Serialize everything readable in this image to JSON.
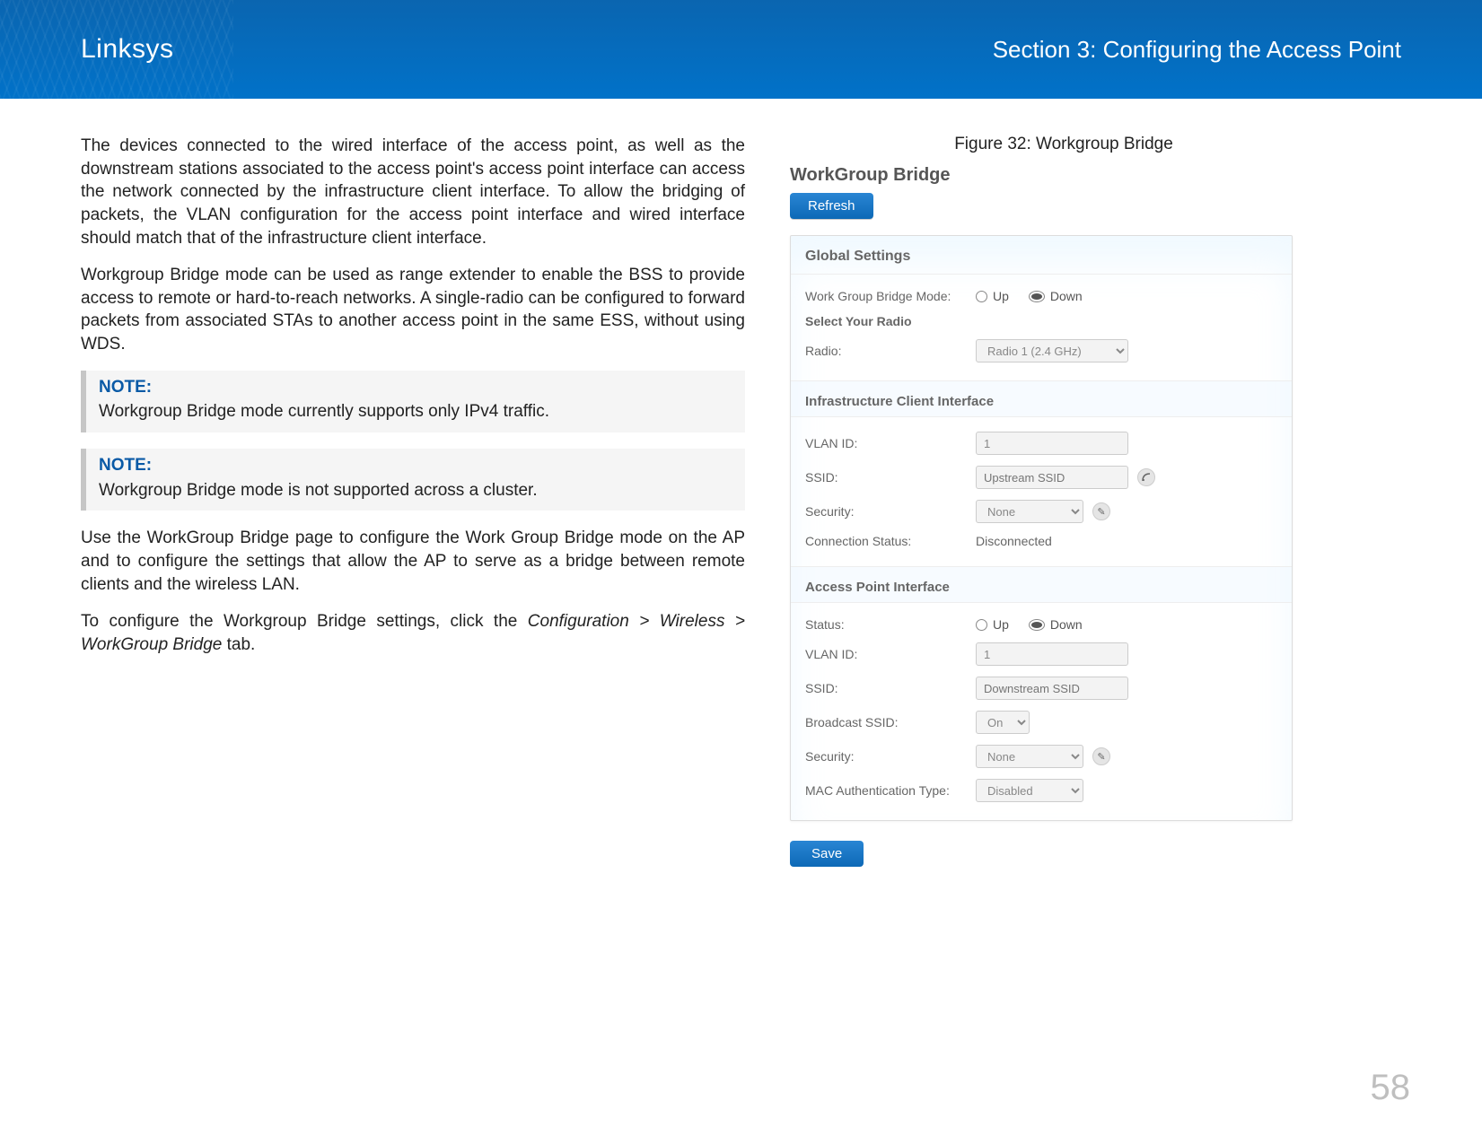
{
  "header": {
    "brand": "Linksys",
    "section": "Section 3:  Configuring the Access Point"
  },
  "left": {
    "p1": "The devices connected to the wired interface of the access point, as well as the downstream stations associated to the access point's access point interface can access the network connected by the infrastructure client interface. To allow the bridging of packets, the VLAN configuration for the access point interface and wired interface should match that of the infrastructure client interface.",
    "p2": "Workgroup Bridge mode can be used as range extender to enable the BSS to provide access to remote or hard-to-reach networks. A single-radio can be configured to forward packets from associated STAs to another access point in the same ESS, without using WDS.",
    "note1_title": "NOTE:",
    "note1_body": "Workgroup Bridge mode currently supports only IPv4 traffic.",
    "note2_title": "NOTE:",
    "note2_body": "Workgroup Bridge mode is not supported across a cluster.",
    "p3": "Use the WorkGroup Bridge page to configure the Work Group Bridge mode on the AP and to configure the settings that allow the AP to serve as a bridge between remote clients and the wireless LAN.",
    "p4_pre": "To configure the Workgroup Bridge settings, click the ",
    "p4_path": "Configuration > Wireless > WorkGroup Bridge",
    "p4_post": " tab."
  },
  "figure": {
    "caption": "Figure 32: Workgroup Bridge",
    "panel_title": "WorkGroup Bridge",
    "refresh": "Refresh",
    "save": "Save",
    "global_settings": "Global Settings",
    "wgb_mode_label": "Work Group Bridge Mode:",
    "up": "Up",
    "down": "Down",
    "select_radio_h": "Select Your Radio",
    "radio_label": "Radio:",
    "radio_value": "Radio 1 (2.4 GHz)",
    "ici_h": "Infrastructure Client Interface",
    "vlan_label": "VLAN ID:",
    "vlan_val": "1",
    "ssid_label": "SSID:",
    "upstream_ssid_ph": "Upstream SSID",
    "security_label": "Security:",
    "security_val": "None",
    "conn_status_label": "Connection Status:",
    "conn_status_val": "Disconnected",
    "api_h": "Access Point Interface",
    "status_label": "Status:",
    "vlan2_val": "1",
    "downstream_ssid_ph": "Downstream SSID",
    "broadcast_label": "Broadcast SSID:",
    "broadcast_val": "On",
    "mac_auth_label": "MAC Authentication Type:",
    "mac_auth_val": "Disabled"
  },
  "page_number": "58"
}
